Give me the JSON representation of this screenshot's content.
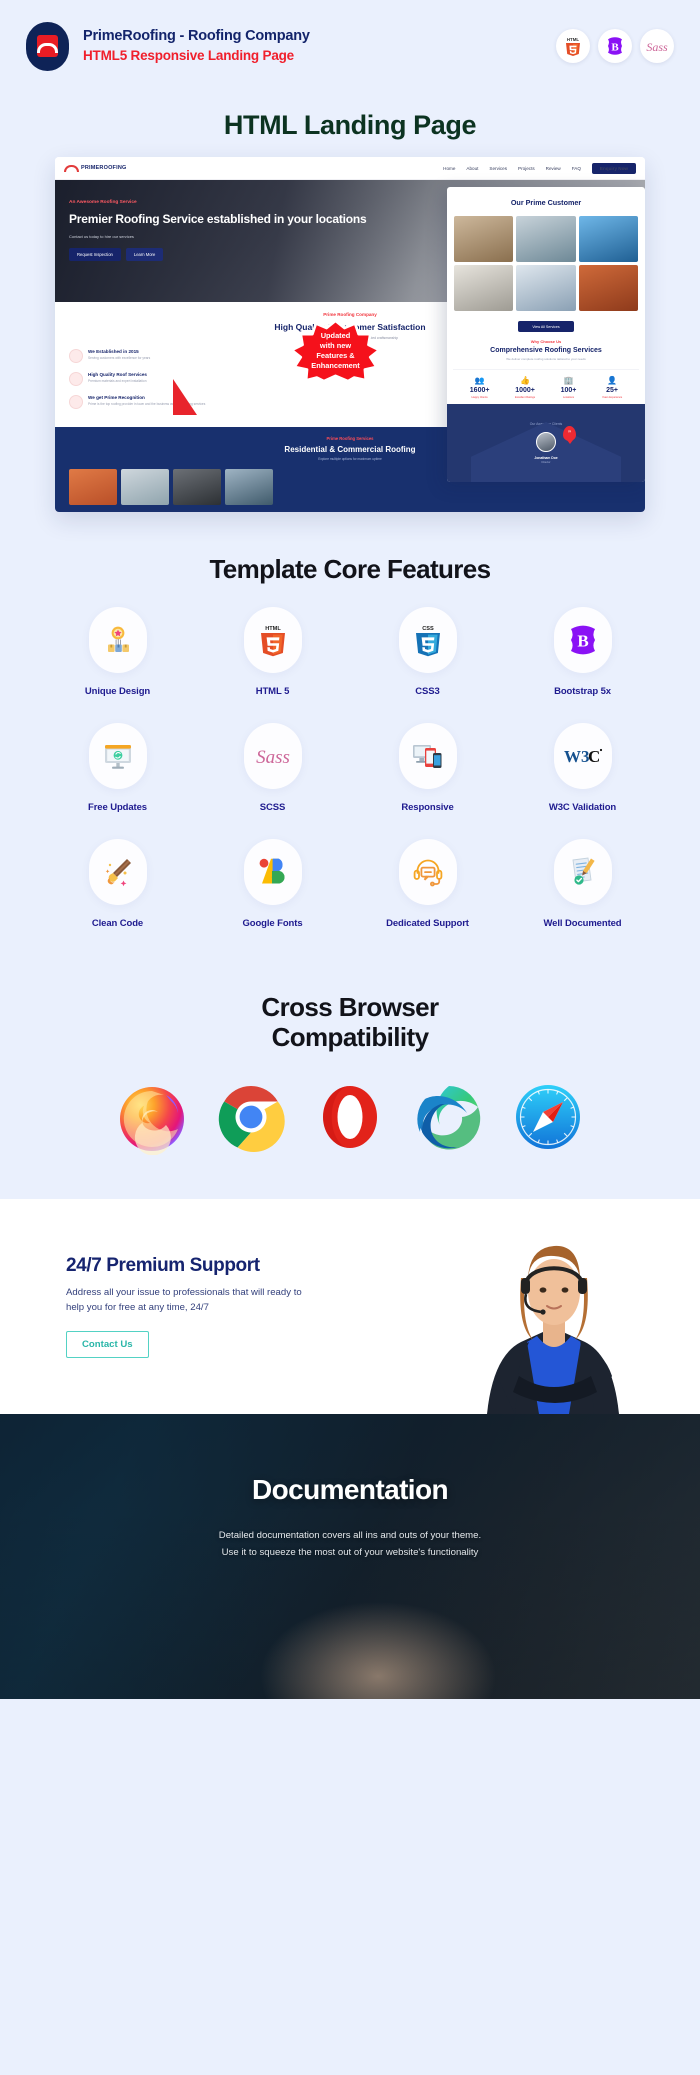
{
  "header": {
    "brand_title": "PrimeRoofing - Roofing Company",
    "brand_subtitle": "HTML5 Responsive Landing Page",
    "logo_icon": "roof-logo-icon",
    "tech_badges": [
      {
        "name": "html5-badge-icon",
        "label": "HTML5"
      },
      {
        "name": "bootstrap-badge-icon",
        "label": "Bootstrap"
      },
      {
        "name": "sass-badge-icon",
        "label": "Sass"
      }
    ]
  },
  "hero": {
    "title": "HTML Landing Page",
    "title_color": "#0c3321",
    "badge": {
      "line1": "Updated",
      "line2": "with new",
      "line3": "Features &",
      "line4": "Enhancement",
      "color": "#f5111b"
    }
  },
  "preview": {
    "nav": {
      "logo": "PRIMEROOFING",
      "items": [
        "Home",
        "About",
        "Services",
        "Projects",
        "Review",
        "FAQ"
      ],
      "cta": "Enquiry Now"
    },
    "hero": {
      "eyebrow": "An Awesome Roofing Service",
      "heading": "Premier Roofing Service established in your locations",
      "sub": "Contact us today to hire our services",
      "btn1": "Request Inspection",
      "btn2": "Learn More"
    },
    "quality": {
      "kicker": "Prime Roofing Company",
      "heading": "High Quality & Customer Satisfaction",
      "sub": "We provide the best roofing solutions with trusted craftsmanship",
      "features": [
        {
          "title": "We Established in 2015",
          "desc": "Serving customers with excellence for years"
        },
        {
          "title": "High Quality Roof Services",
          "desc": "Premium materials and expert installation"
        },
        {
          "title": "We get Prime Recognition",
          "desc": "Prime is the top roofing provider in town and the business award in roofing services"
        }
      ]
    },
    "dark": {
      "kicker": "Prime Roofing Services",
      "heading": "Residential & Commercial Roofing",
      "sub": "Explore multiple options for maximum uptime"
    },
    "overlay": {
      "kicker": "Our Prime Customer",
      "heading": "Our Prime Customer",
      "cta": "View All Services",
      "why_kicker": "Why Choose Us",
      "why_heading": "Comprehensive Roofing Services",
      "why_sub": "We deliver complete roofing solutions tailored to your needs",
      "stats": [
        {
          "number": "1600+",
          "label": "Happy Clients",
          "icon": "people-icon"
        },
        {
          "number": "1000+",
          "label": "Excellent Ratings",
          "icon": "ratings-icon"
        },
        {
          "number": "100+",
          "label": "Locations",
          "icon": "locations-icon"
        },
        {
          "number": "25+",
          "label": "Years Experience",
          "icon": "experience-icon"
        }
      ],
      "testimonial_kicker": "Our Awesome Clients",
      "testimonial_name": "Jonatham Doe",
      "testimonial_role": "Director",
      "quote_glyph": "”"
    }
  },
  "features": {
    "title": "Template Core Features",
    "items": [
      {
        "label": "Unique Design",
        "icon": "award-badge-icon"
      },
      {
        "label": "HTML 5",
        "icon": "html5-icon"
      },
      {
        "label": "CSS3",
        "icon": "css3-icon"
      },
      {
        "label": "Bootstrap 5x",
        "icon": "bootstrap-icon"
      },
      {
        "label": "Free Updates",
        "icon": "monitor-refresh-icon"
      },
      {
        "label": "SCSS",
        "icon": "sass-icon"
      },
      {
        "label": "Responsive",
        "icon": "devices-icon"
      },
      {
        "label": "W3C Validation",
        "icon": "w3c-icon"
      },
      {
        "label": "Clean Code",
        "icon": "paintbrush-icon"
      },
      {
        "label": "Google Fonts",
        "icon": "google-fonts-icon"
      },
      {
        "label": "Dedicated Support",
        "icon": "headset-icon"
      },
      {
        "label": "Well Documented",
        "icon": "document-check-icon"
      }
    ]
  },
  "browsers": {
    "title_line1": "Cross Browser",
    "title_line2": "Compatibility",
    "items": [
      {
        "name": "firefox-icon",
        "label": "Firefox"
      },
      {
        "name": "chrome-icon",
        "label": "Chrome"
      },
      {
        "name": "opera-icon",
        "label": "Opera"
      },
      {
        "name": "edge-icon",
        "label": "Microsoft Edge"
      },
      {
        "name": "safari-icon",
        "label": "Safari"
      }
    ]
  },
  "support": {
    "title": "24/7 Premium Support",
    "description_line1": "Address all your issue to professionals that will ready to",
    "description_line2": "help you for free at any time, 24/7",
    "button_label": "Contact Us",
    "button_color": "#29b6a8",
    "photo": "support-agent-photo"
  },
  "documentation": {
    "title": "Documentation",
    "line1": "Detailed documentation covers all ins and outs of your theme.",
    "line2": "Use it to squeeze the most out of your website's functionality"
  }
}
